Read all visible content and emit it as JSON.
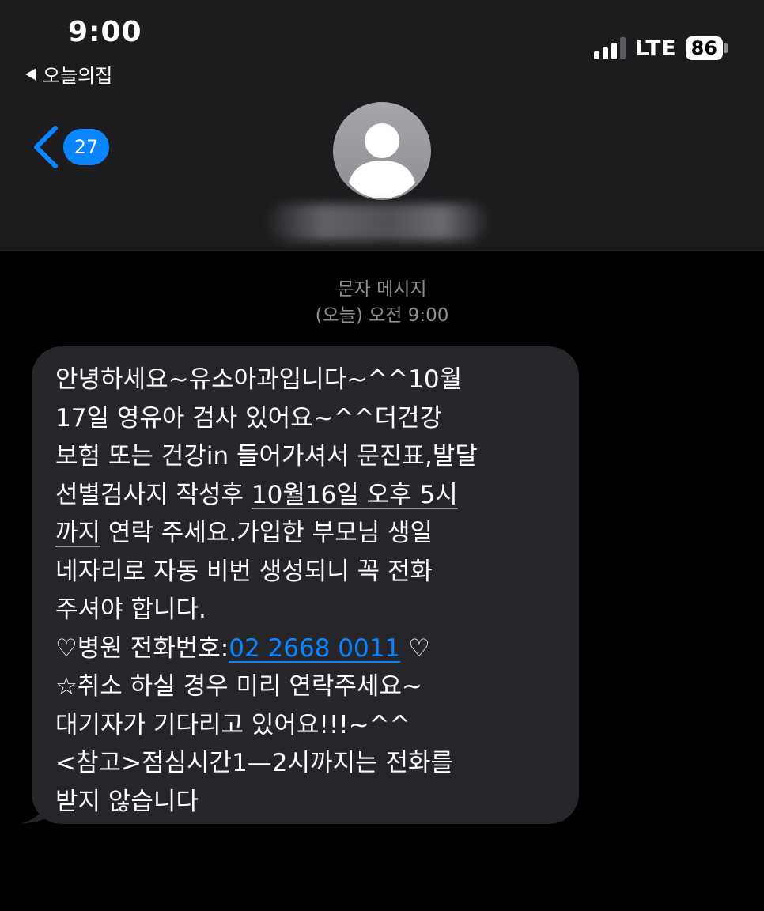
{
  "status_bar": {
    "time": "9:00",
    "back_app": "오늘의집",
    "network": "LTE",
    "battery": "86"
  },
  "nav": {
    "back_count": "27"
  },
  "colors": {
    "header_bg": "#1c1c1e",
    "bubble_bg": "#26252a",
    "accent": "#0a84ff",
    "meta_text": "#8e8e93"
  },
  "thread": {
    "service": "문자 메시지",
    "timestamp": "(오늘) 오전 9:00"
  },
  "message": {
    "l1": "안녕하세요~유소아과입니다~^^10월",
    "l2": "17일 영유아 검사 있어요~^^더건강",
    "l3": "보험 또는 건강in 들어가셔서 문진표,발달",
    "l4_a": "선별검사지  작성후 ",
    "l4_date": "10월16일 오후 5시",
    "l5_date": "까지",
    "l5_b": " 연락 주세요.가입한 부모님 생일",
    "l6": "네자리로 자동 비번 생성되니 꼭 전화",
    "l7": "주셔야 합니다.",
    "l8_a": "♡병원 전화번호:",
    "l8_phone": "02 2668 0011",
    "l8_b": " ♡",
    "l9": "☆취소 하실 경우 미리 연락주세요~",
    "l10": "대기자가 기다리고 있어요!!!~^^",
    "l11": "<참고>점심시간1—2시까지는 전화를",
    "l12": "받지 않습니다"
  }
}
